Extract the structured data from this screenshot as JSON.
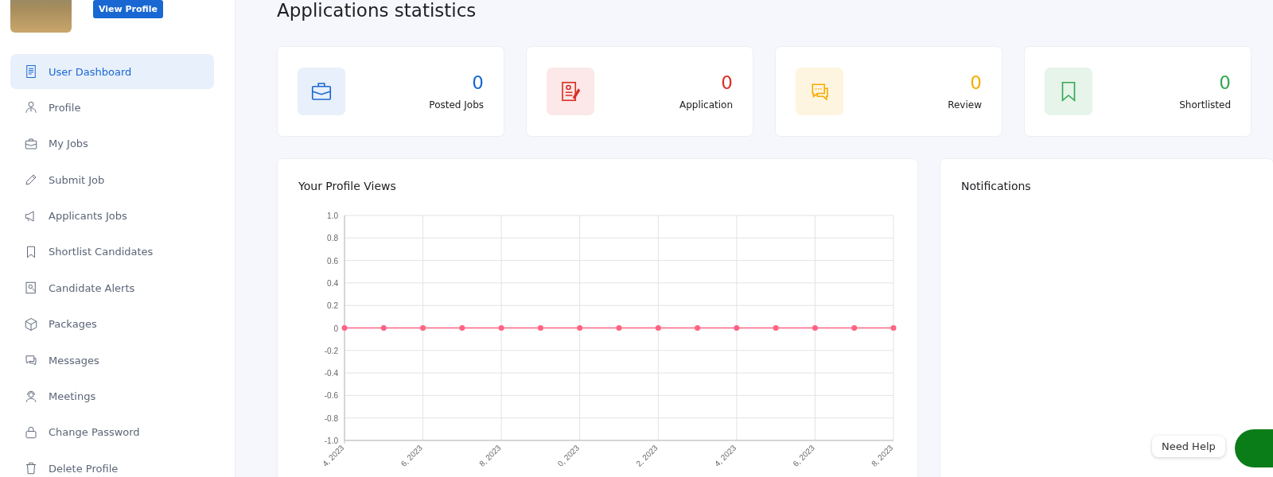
{
  "sidebar": {
    "view_profile_button": "View Profile",
    "items": [
      {
        "label": "User Dashboard",
        "selected": true
      },
      {
        "label": "Profile",
        "selected": false
      },
      {
        "label": "My Jobs",
        "selected": false
      },
      {
        "label": "Submit Job",
        "selected": false
      },
      {
        "label": "Applicants Jobs",
        "selected": false
      },
      {
        "label": "Shortlist Candidates",
        "selected": false
      },
      {
        "label": "Candidate Alerts",
        "selected": false
      },
      {
        "label": "Packages",
        "selected": false
      },
      {
        "label": "Messages",
        "selected": false
      },
      {
        "label": "Meetings",
        "selected": false
      },
      {
        "label": "Change Password",
        "selected": false
      },
      {
        "label": "Delete Profile",
        "selected": false
      }
    ]
  },
  "page_title": "Applications statistics",
  "stats": [
    {
      "value": "0",
      "label": "Posted Jobs",
      "color": "#1967d2"
    },
    {
      "value": "0",
      "label": "Application",
      "color": "#d93025"
    },
    {
      "value": "0",
      "label": "Review",
      "color": "#f9ab00"
    },
    {
      "value": "0",
      "label": "Shortlisted",
      "color": "#34a853"
    }
  ],
  "profile_views": {
    "title": "Your Profile Views",
    "chart_data": {
      "type": "line",
      "categories": [
        "4, 2023",
        null,
        "6, 2023",
        null,
        "8, 2023",
        null,
        "0, 2023",
        null,
        "2, 2023",
        null,
        "4, 2023",
        null,
        "6, 2023",
        null,
        "8, 2023"
      ],
      "grid": true,
      "series": [
        {
          "color": "#ff6384",
          "marker": true,
          "values": [
            0,
            0,
            0,
            0,
            0,
            0,
            0,
            0,
            0,
            0,
            0,
            0,
            0,
            0,
            0
          ]
        }
      ],
      "ylim": [
        -1,
        1
      ],
      "yticks": [
        {
          "value": 1,
          "label": "1.0"
        },
        {
          "value": 0.8,
          "label": "0.8"
        },
        {
          "value": 0.6,
          "label": "0.6"
        },
        {
          "value": 0.4,
          "label": "0.4"
        },
        {
          "value": 0.2,
          "label": "0.2"
        },
        {
          "value": 0,
          "label": "0"
        },
        {
          "value": -0.2,
          "label": "-0.2"
        },
        {
          "value": -0.4,
          "label": "-0.4"
        },
        {
          "value": -0.6,
          "label": "-0.6"
        },
        {
          "value": -0.8,
          "label": "-0.8"
        },
        {
          "value": -1,
          "label": "-1.0"
        }
      ]
    }
  },
  "notifications": {
    "title": "Notifications"
  },
  "help": {
    "label": "Need Help"
  }
}
